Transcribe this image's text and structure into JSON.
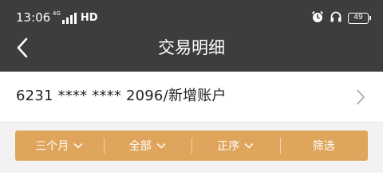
{
  "status_bar": {
    "time": "13:06",
    "network_label": "4G",
    "hd_label": "HD",
    "battery": "49",
    "icons": [
      "signal-icon",
      "alarm-icon",
      "headset-icon",
      "battery-icon"
    ]
  },
  "header": {
    "title": "交易明细",
    "back_icon": "chevron-left-icon",
    "background": "#3d3d3d"
  },
  "account": {
    "label": "6231 **** **** 2096/新增账户",
    "chevron_icon": "chevron-right-icon"
  },
  "filters": {
    "accent": "#dfa55c",
    "items": [
      {
        "label": "三个月",
        "has_dropdown": true
      },
      {
        "label": "全部",
        "has_dropdown": true
      },
      {
        "label": "正序",
        "has_dropdown": true
      },
      {
        "label": "筛选",
        "has_dropdown": false
      }
    ]
  }
}
